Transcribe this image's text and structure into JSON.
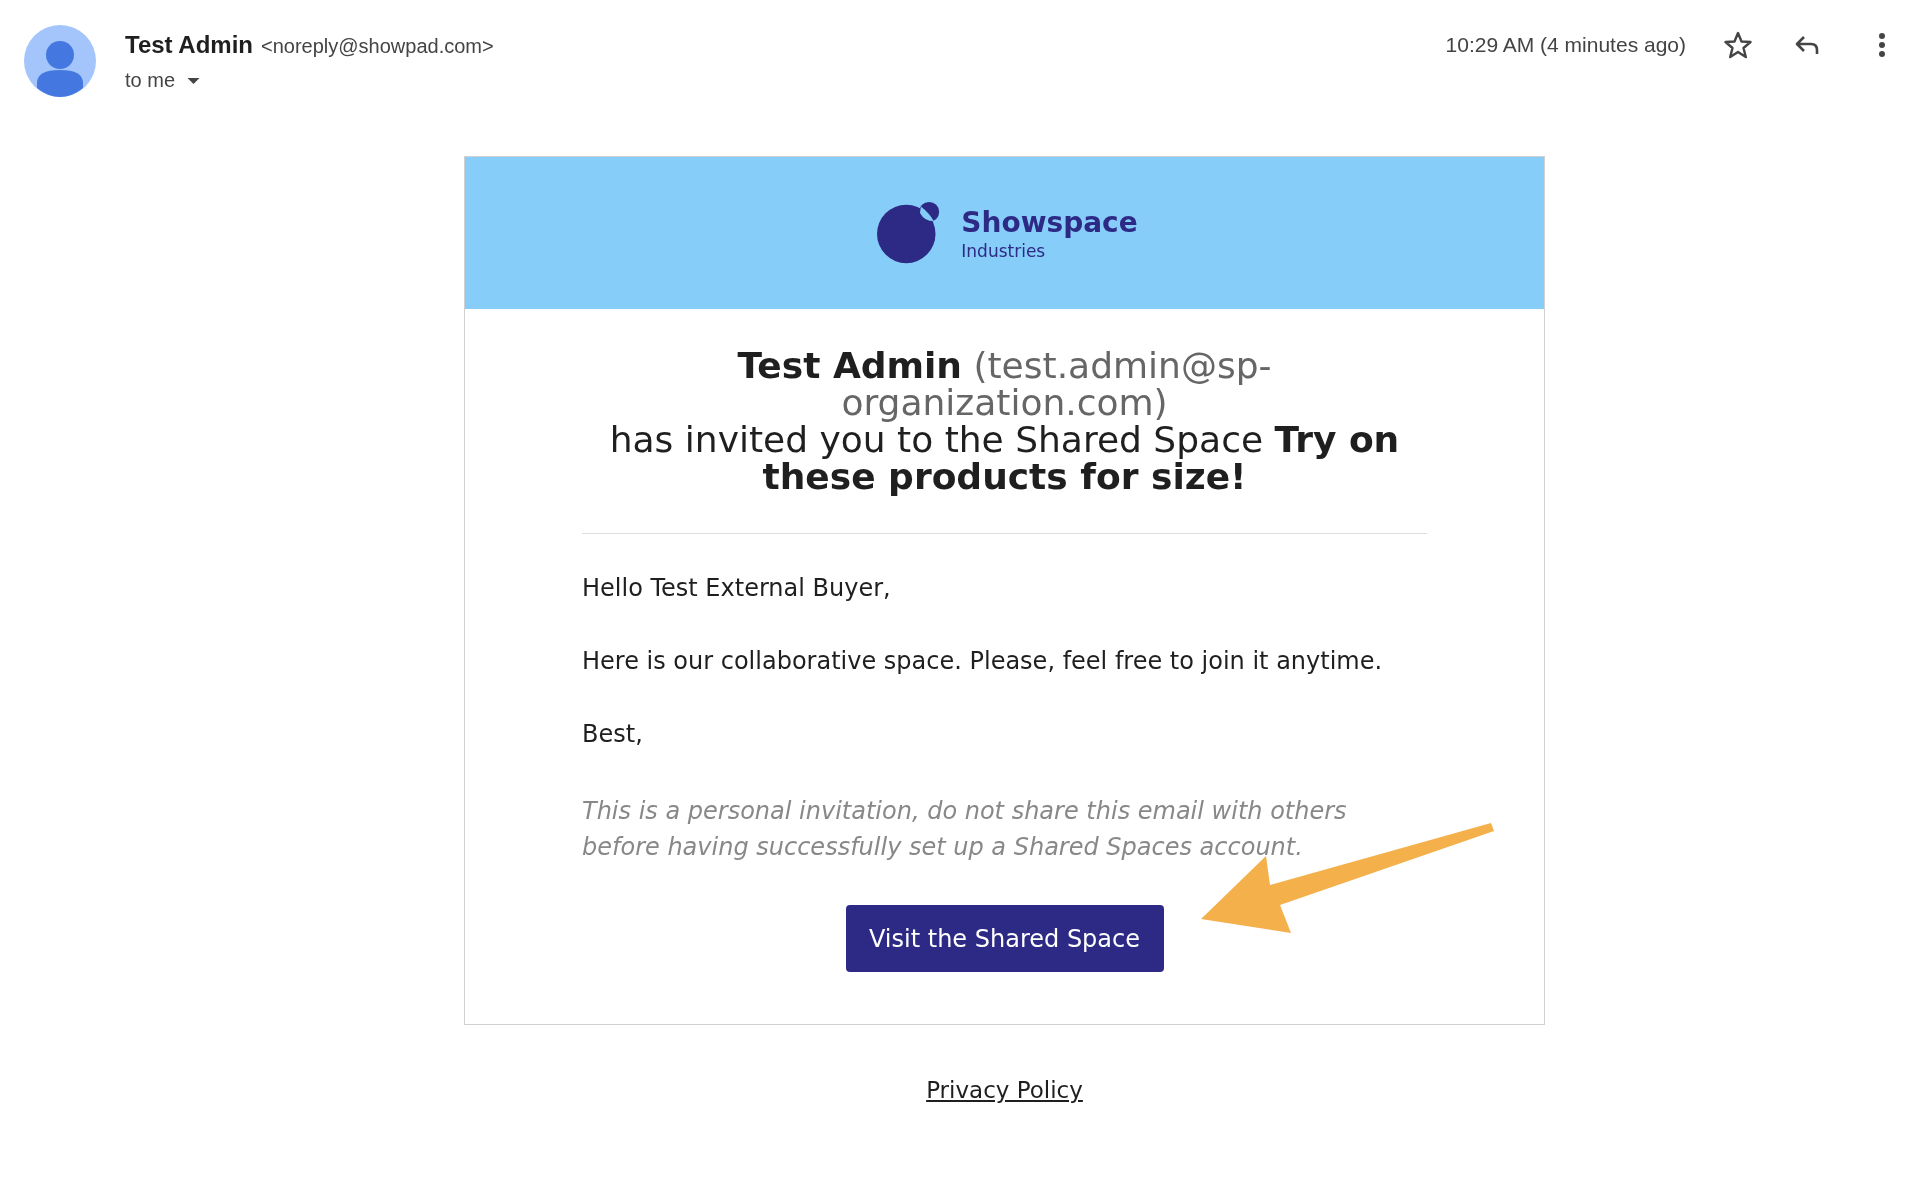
{
  "header": {
    "sender_name": "Test Admin",
    "sender_email": "<noreply@showpad.com>",
    "recipient": "to me",
    "time": "10:29 AM (4 minutes ago)",
    "starred": false
  },
  "email": {
    "logo": {
      "name": "Showspace",
      "tagline": "Industries"
    },
    "headline": {
      "inviter": "Test Admin",
      "inviter_email": "(test.admin@sp-organization.com)",
      "text": "has invited you to the Shared Space",
      "space_name": "Try on these products for size!"
    },
    "paragraphs": [
      "Hello Test External Buyer,",
      "Here is our collaborative space. Please, feel free to join it anytime.",
      "Best,"
    ],
    "note": "This is a personal invitation, do not share this email with others before having successfully set up a Shared Spaces account.",
    "button": "Visit the Shared Space"
  },
  "footer": {
    "link": "Privacy Policy"
  }
}
